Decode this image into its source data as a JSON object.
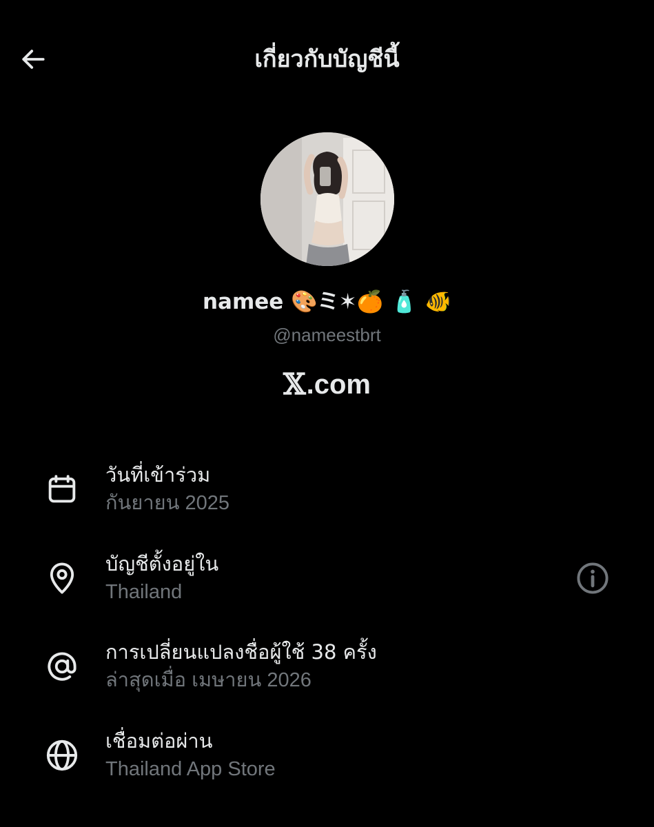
{
  "header": {
    "title": "เกี่ยวกับบัญชีนี้",
    "back_icon": "arrow-left-icon"
  },
  "profile": {
    "display_name": "namee 🎨ミ✶🍊 🧴 🐠",
    "handle": "@nameestbrt",
    "brand_text": ".com",
    "brand_logo_letter": "𝕏"
  },
  "info": [
    {
      "icon": "calendar-icon",
      "label": "วันที่เข้าร่วม",
      "value": "กันยายน 2025"
    },
    {
      "icon": "location-pin-icon",
      "label": "บัญชีตั้งอยู่ใน",
      "value": "Thailand",
      "extra_icon": "info-circle-icon"
    },
    {
      "icon": "at-sign-icon",
      "label": "การเปลี่ยนแปลงชื่อผู้ใช้ 38 ครั้ง",
      "value": "ล่าสุดเมื่อ เมษายน 2026"
    },
    {
      "icon": "globe-icon",
      "label": "เชื่อมต่อผ่าน",
      "value": "Thailand App Store"
    }
  ],
  "colors": {
    "background": "#000000",
    "primary_text": "#e7e9ea",
    "secondary_text": "#71767b"
  }
}
